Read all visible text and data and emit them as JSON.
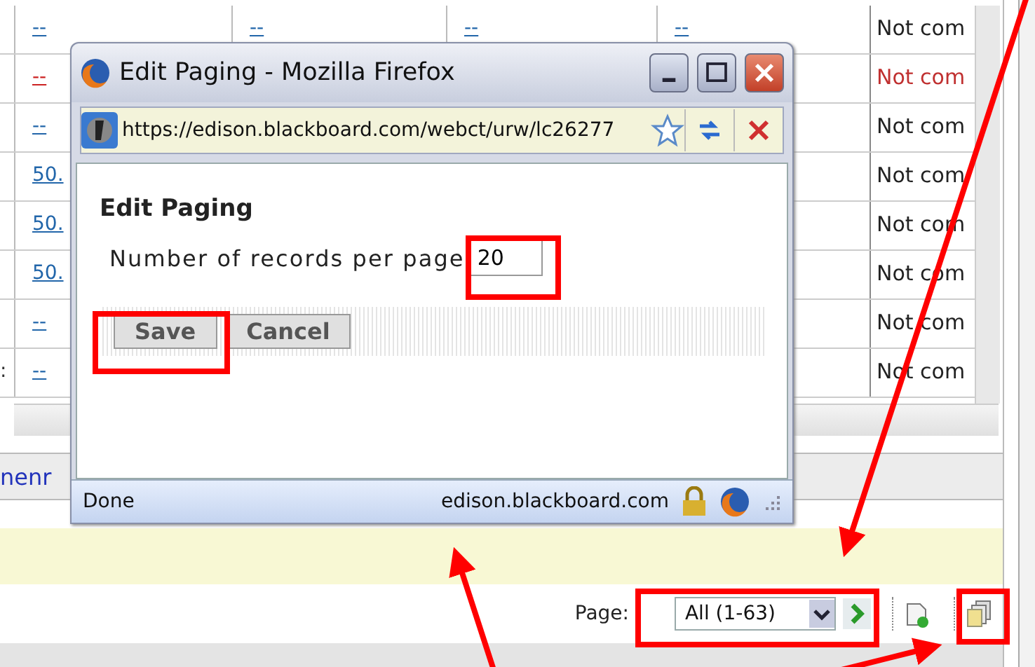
{
  "grid": {
    "rows": [
      {
        "stub": "",
        "cells": [
          "--",
          "--",
          "--",
          "--"
        ],
        "status": "Not com",
        "flagged": false
      },
      {
        "stub": "",
        "cells": [
          "--"
        ],
        "status": "Not com",
        "flagged": true
      },
      {
        "stub": "",
        "cells": [
          "--"
        ],
        "status": "Not com",
        "flagged": false
      },
      {
        "stub": "",
        "cells": [
          "50."
        ],
        "status": "Not com",
        "flagged": false
      },
      {
        "stub": "",
        "cells": [
          "50."
        ],
        "status": "Not com",
        "flagged": false
      },
      {
        "stub": "",
        "cells": [
          "50."
        ],
        "status": "Not com",
        "flagged": false
      },
      {
        "stub": "",
        "cells": [
          "--"
        ],
        "status": "Not com",
        "flagged": false
      },
      {
        "stub": ":",
        "cells": [
          "--"
        ],
        "status": "Not com",
        "flagged": false
      }
    ]
  },
  "action_link": "nenr",
  "pager": {
    "label": "Page:",
    "select": "All (1-63)"
  },
  "popup": {
    "title": "Edit Paging - Mozilla Firefox",
    "url": "https://edison.blackboard.com/webct/urw/lc26277",
    "heading": "Edit Paging",
    "field_label": "Number of records per page",
    "field_value": "20",
    "buttons": [
      "Save",
      "Cancel"
    ],
    "status": "Done",
    "domain": "edison.blackboard.com"
  }
}
